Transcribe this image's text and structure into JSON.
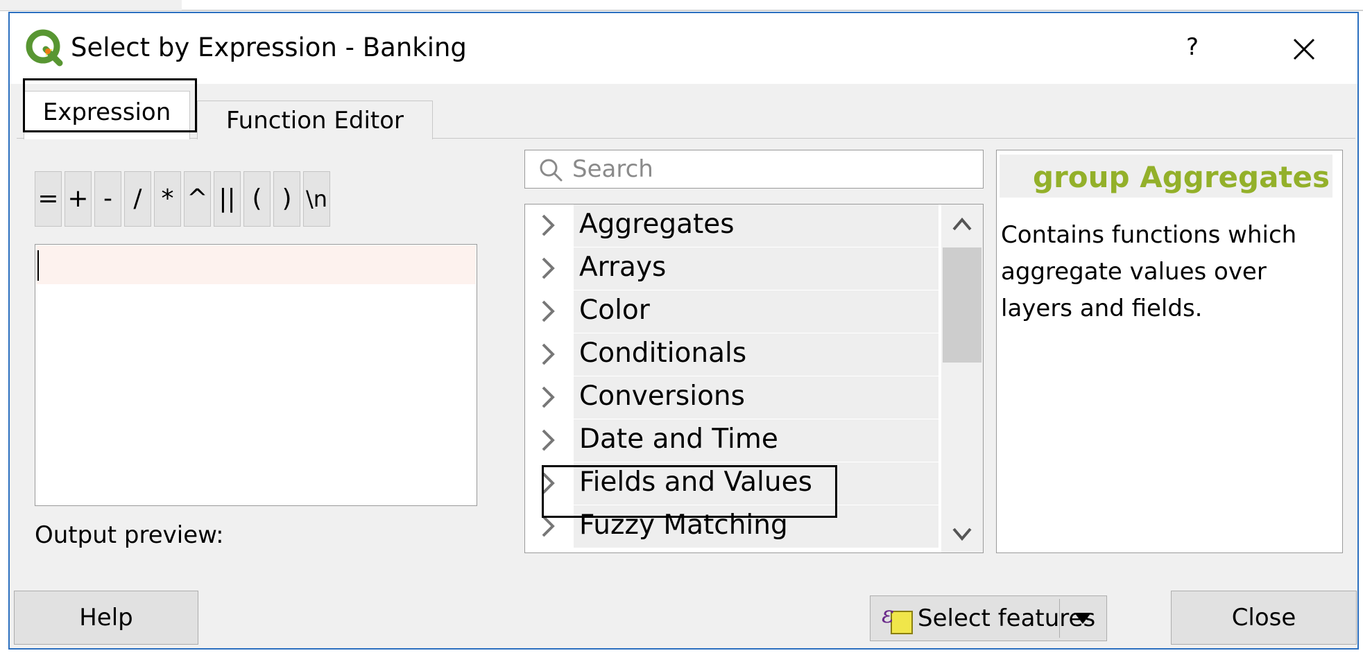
{
  "window": {
    "title": "Select by Expression - Banking",
    "help_symbol": "?"
  },
  "tabs": [
    {
      "label": "Expression",
      "active": true
    },
    {
      "label": "Function Editor",
      "active": false
    }
  ],
  "operators": [
    "=",
    "+",
    "-",
    "/",
    "*",
    "^",
    "||",
    "(",
    ")",
    "\\n"
  ],
  "expression": {
    "value": "",
    "output_preview_label": "Output preview:"
  },
  "search": {
    "placeholder": "Search"
  },
  "function_groups": [
    "Aggregates",
    "Arrays",
    "Color",
    "Conditionals",
    "Conversions",
    "Date and Time",
    "Fields and Values",
    "Fuzzy Matching"
  ],
  "help_panel": {
    "title": "group Aggregates",
    "description": "Contains functions which aggregate values over layers and fields."
  },
  "buttons": {
    "help": "Help",
    "select_features": "Select features",
    "close": "Close"
  },
  "colors": {
    "accent_border": "#2b6fbf",
    "help_title": "#93b02a",
    "qgis_green": "#589632",
    "qgis_yellow": "#f0e64a"
  },
  "icons": {
    "app": "qgis-logo-icon",
    "close": "close-icon",
    "search": "search-icon",
    "expand": "chevron-right-icon",
    "scroll_up": "chevron-up-icon",
    "scroll_down": "chevron-down-icon",
    "select_features": "expression-select-icon",
    "dropdown": "triangle-down-icon"
  }
}
